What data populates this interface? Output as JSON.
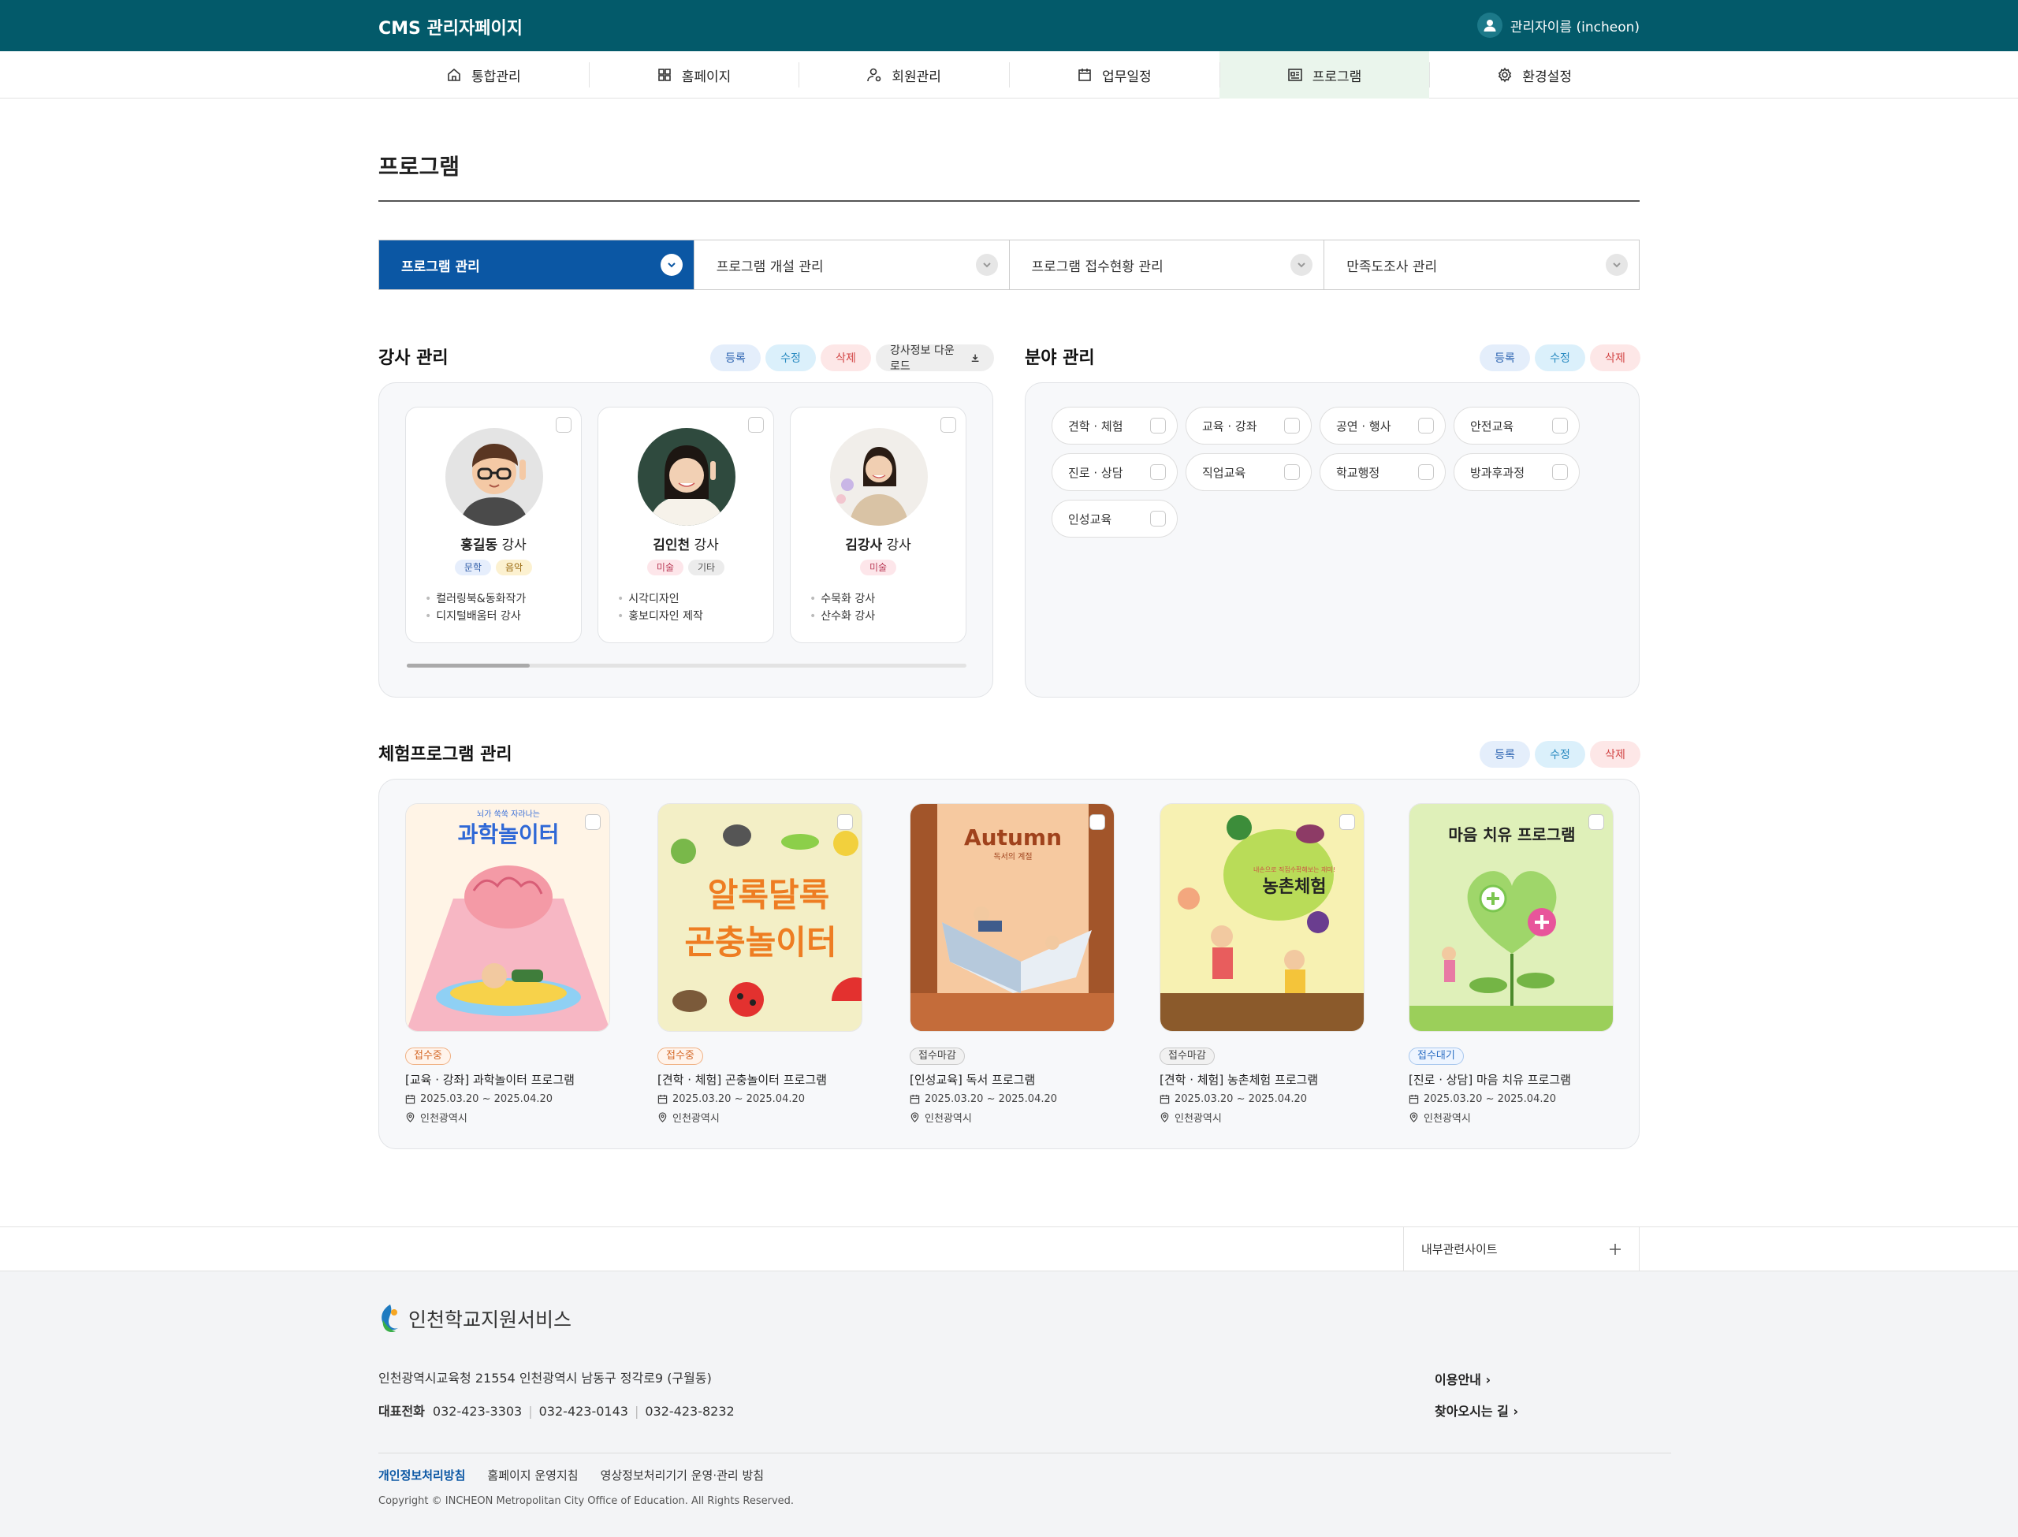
{
  "header": {
    "brand": "CMS  관리자페이지",
    "user": "관리자이름 (incheon)"
  },
  "nav": [
    {
      "label": "통합관리",
      "icon": "home-icon"
    },
    {
      "label": "홈페이지",
      "icon": "grid-icon"
    },
    {
      "label": "회원관리",
      "icon": "user-settings-icon"
    },
    {
      "label": "업무일정",
      "icon": "calendar-icon"
    },
    {
      "label": "프로그램",
      "icon": "program-list-icon",
      "active": true
    },
    {
      "label": "환경설정",
      "icon": "gear-icon"
    }
  ],
  "page_title": "프로그램",
  "tabs": [
    {
      "label": "프로그램 관리",
      "active": true
    },
    {
      "label": "프로그램 개설 관리"
    },
    {
      "label": "프로그램 접수현황 관리"
    },
    {
      "label": "만족도조사 관리"
    }
  ],
  "buttons": {
    "register": "등록",
    "edit": "수정",
    "delete": "삭제",
    "download": "강사정보 다운로드"
  },
  "instructors": {
    "title": "강사 관리",
    "items": [
      {
        "name": "홍길동",
        "suffix": " 강사",
        "tags": [
          "문학",
          "음악"
        ],
        "lines": [
          "컬러링북&동화작가",
          "디지털배움터 강사"
        ]
      },
      {
        "name": "김인천",
        "suffix": " 강사",
        "tags": [
          "미술",
          "기타"
        ],
        "lines": [
          "시각디자인",
          "홍보디자인 제작"
        ]
      },
      {
        "name": "김강사",
        "suffix": " 강사",
        "tags": [
          "미술"
        ],
        "lines": [
          "수묵화 강사",
          "산수화 강사"
        ]
      }
    ],
    "scroll_position": 0.22
  },
  "fields": {
    "title": "분야 관리",
    "items": [
      "견학 · 체험",
      "교육 · 강좌",
      "공연 · 행사",
      "안전교육",
      "진로 · 상담",
      "직업교육",
      "학교행정",
      "방과후과정",
      "인성교육"
    ]
  },
  "programs": {
    "title": "체험프로그램 관리",
    "items": [
      {
        "status": "접수중",
        "status_type": "on",
        "title": "[교육 · 강좌]  과학놀이터 프로그램",
        "period": "2025.03.20 ~ 2025.04.20",
        "place": "인천광역시",
        "poster_text": "과학놀이터",
        "poster_sub": "뇌가 쑥쑥 자라나는"
      },
      {
        "status": "접수중",
        "status_type": "on",
        "title": "[견학 · 체험]  곤충놀이터 프로그램",
        "period": "2025.03.20 ~ 2025.04.20",
        "place": "인천광역시",
        "poster_text": "알록달록",
        "poster_sub": "곤충놀이터"
      },
      {
        "status": "접수마감",
        "status_type": "off",
        "title": "[인성교육]  독서 프로그램",
        "period": "2025.03.20 ~ 2025.04.20",
        "place": "인천광역시",
        "poster_text": "Autumn",
        "poster_sub": "독서의 계절"
      },
      {
        "status": "접수마감",
        "status_type": "off",
        "title": "[견학 · 체험]  농촌체험 프로그램",
        "period": "2025.03.20 ~ 2025.04.20",
        "place": "인천광역시",
        "poster_text": "농촌체험",
        "poster_sub": "내손으로 직접수확해보는 재미!"
      },
      {
        "status": "접수대기",
        "status_type": "wait",
        "title": "[진로 · 상담]  마음 치유 프로그램",
        "period": "2025.03.20 ~ 2025.04.20",
        "place": "인천광역시",
        "poster_text": "마음 치유 프로그램",
        "poster_sub": ""
      }
    ]
  },
  "related_sites": "내부관련사이트",
  "footer": {
    "logo": "인천학교지원서비스",
    "address": "인천광역시교육청 21554 인천광역시 남동구 정각로9 (구월동)",
    "tel_label": "대표전화",
    "tels": [
      "032-423-3303",
      "032-423-0143",
      "032-423-8232"
    ],
    "guide": [
      "이용안내",
      "찾아오시는 길"
    ],
    "links": [
      "개인정보처리방침",
      "홈페이지 운영지침",
      "영상정보처리기기 운영·관리 방침"
    ],
    "copyright": "Copyright © INCHEON Metropolitan City Office of Education. All Rights Reserved."
  },
  "colors": {
    "header_bg": "#035a6a",
    "tab_active": "#0b57a4",
    "nav_active_bg": "#eaf5ec"
  }
}
